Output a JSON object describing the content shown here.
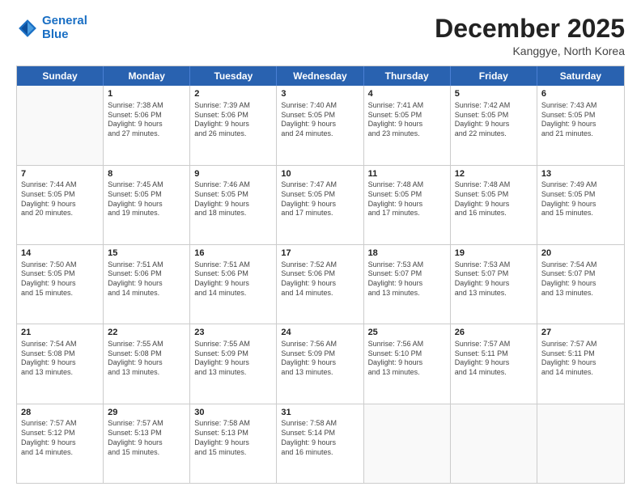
{
  "logo": {
    "line1": "General",
    "line2": "Blue"
  },
  "title": "December 2025",
  "subtitle": "Kanggye, North Korea",
  "days": [
    "Sunday",
    "Monday",
    "Tuesday",
    "Wednesday",
    "Thursday",
    "Friday",
    "Saturday"
  ],
  "weeks": [
    [
      {
        "day": "",
        "sunrise": "",
        "sunset": "",
        "daylight": ""
      },
      {
        "day": "1",
        "sunrise": "Sunrise: 7:38 AM",
        "sunset": "Sunset: 5:06 PM",
        "daylight": "Daylight: 9 hours and 27 minutes."
      },
      {
        "day": "2",
        "sunrise": "Sunrise: 7:39 AM",
        "sunset": "Sunset: 5:06 PM",
        "daylight": "Daylight: 9 hours and 26 minutes."
      },
      {
        "day": "3",
        "sunrise": "Sunrise: 7:40 AM",
        "sunset": "Sunset: 5:05 PM",
        "daylight": "Daylight: 9 hours and 24 minutes."
      },
      {
        "day": "4",
        "sunrise": "Sunrise: 7:41 AM",
        "sunset": "Sunset: 5:05 PM",
        "daylight": "Daylight: 9 hours and 23 minutes."
      },
      {
        "day": "5",
        "sunrise": "Sunrise: 7:42 AM",
        "sunset": "Sunset: 5:05 PM",
        "daylight": "Daylight: 9 hours and 22 minutes."
      },
      {
        "day": "6",
        "sunrise": "Sunrise: 7:43 AM",
        "sunset": "Sunset: 5:05 PM",
        "daylight": "Daylight: 9 hours and 21 minutes."
      }
    ],
    [
      {
        "day": "7",
        "sunrise": "Sunrise: 7:44 AM",
        "sunset": "Sunset: 5:05 PM",
        "daylight": "Daylight: 9 hours and 20 minutes."
      },
      {
        "day": "8",
        "sunrise": "Sunrise: 7:45 AM",
        "sunset": "Sunset: 5:05 PM",
        "daylight": "Daylight: 9 hours and 19 minutes."
      },
      {
        "day": "9",
        "sunrise": "Sunrise: 7:46 AM",
        "sunset": "Sunset: 5:05 PM",
        "daylight": "Daylight: 9 hours and 18 minutes."
      },
      {
        "day": "10",
        "sunrise": "Sunrise: 7:47 AM",
        "sunset": "Sunset: 5:05 PM",
        "daylight": "Daylight: 9 hours and 17 minutes."
      },
      {
        "day": "11",
        "sunrise": "Sunrise: 7:48 AM",
        "sunset": "Sunset: 5:05 PM",
        "daylight": "Daylight: 9 hours and 17 minutes."
      },
      {
        "day": "12",
        "sunrise": "Sunrise: 7:48 AM",
        "sunset": "Sunset: 5:05 PM",
        "daylight": "Daylight: 9 hours and 16 minutes."
      },
      {
        "day": "13",
        "sunrise": "Sunrise: 7:49 AM",
        "sunset": "Sunset: 5:05 PM",
        "daylight": "Daylight: 9 hours and 15 minutes."
      }
    ],
    [
      {
        "day": "14",
        "sunrise": "Sunrise: 7:50 AM",
        "sunset": "Sunset: 5:05 PM",
        "daylight": "Daylight: 9 hours and 15 minutes."
      },
      {
        "day": "15",
        "sunrise": "Sunrise: 7:51 AM",
        "sunset": "Sunset: 5:06 PM",
        "daylight": "Daylight: 9 hours and 14 minutes."
      },
      {
        "day": "16",
        "sunrise": "Sunrise: 7:51 AM",
        "sunset": "Sunset: 5:06 PM",
        "daylight": "Daylight: 9 hours and 14 minutes."
      },
      {
        "day": "17",
        "sunrise": "Sunrise: 7:52 AM",
        "sunset": "Sunset: 5:06 PM",
        "daylight": "Daylight: 9 hours and 14 minutes."
      },
      {
        "day": "18",
        "sunrise": "Sunrise: 7:53 AM",
        "sunset": "Sunset: 5:07 PM",
        "daylight": "Daylight: 9 hours and 13 minutes."
      },
      {
        "day": "19",
        "sunrise": "Sunrise: 7:53 AM",
        "sunset": "Sunset: 5:07 PM",
        "daylight": "Daylight: 9 hours and 13 minutes."
      },
      {
        "day": "20",
        "sunrise": "Sunrise: 7:54 AM",
        "sunset": "Sunset: 5:07 PM",
        "daylight": "Daylight: 9 hours and 13 minutes."
      }
    ],
    [
      {
        "day": "21",
        "sunrise": "Sunrise: 7:54 AM",
        "sunset": "Sunset: 5:08 PM",
        "daylight": "Daylight: 9 hours and 13 minutes."
      },
      {
        "day": "22",
        "sunrise": "Sunrise: 7:55 AM",
        "sunset": "Sunset: 5:08 PM",
        "daylight": "Daylight: 9 hours and 13 minutes."
      },
      {
        "day": "23",
        "sunrise": "Sunrise: 7:55 AM",
        "sunset": "Sunset: 5:09 PM",
        "daylight": "Daylight: 9 hours and 13 minutes."
      },
      {
        "day": "24",
        "sunrise": "Sunrise: 7:56 AM",
        "sunset": "Sunset: 5:09 PM",
        "daylight": "Daylight: 9 hours and 13 minutes."
      },
      {
        "day": "25",
        "sunrise": "Sunrise: 7:56 AM",
        "sunset": "Sunset: 5:10 PM",
        "daylight": "Daylight: 9 hours and 13 minutes."
      },
      {
        "day": "26",
        "sunrise": "Sunrise: 7:57 AM",
        "sunset": "Sunset: 5:11 PM",
        "daylight": "Daylight: 9 hours and 14 minutes."
      },
      {
        "day": "27",
        "sunrise": "Sunrise: 7:57 AM",
        "sunset": "Sunset: 5:11 PM",
        "daylight": "Daylight: 9 hours and 14 minutes."
      }
    ],
    [
      {
        "day": "28",
        "sunrise": "Sunrise: 7:57 AM",
        "sunset": "Sunset: 5:12 PM",
        "daylight": "Daylight: 9 hours and 14 minutes."
      },
      {
        "day": "29",
        "sunrise": "Sunrise: 7:57 AM",
        "sunset": "Sunset: 5:13 PM",
        "daylight": "Daylight: 9 hours and 15 minutes."
      },
      {
        "day": "30",
        "sunrise": "Sunrise: 7:58 AM",
        "sunset": "Sunset: 5:13 PM",
        "daylight": "Daylight: 9 hours and 15 minutes."
      },
      {
        "day": "31",
        "sunrise": "Sunrise: 7:58 AM",
        "sunset": "Sunset: 5:14 PM",
        "daylight": "Daylight: 9 hours and 16 minutes."
      },
      {
        "day": "",
        "sunrise": "",
        "sunset": "",
        "daylight": ""
      },
      {
        "day": "",
        "sunrise": "",
        "sunset": "",
        "daylight": ""
      },
      {
        "day": "",
        "sunrise": "",
        "sunset": "",
        "daylight": ""
      }
    ]
  ]
}
